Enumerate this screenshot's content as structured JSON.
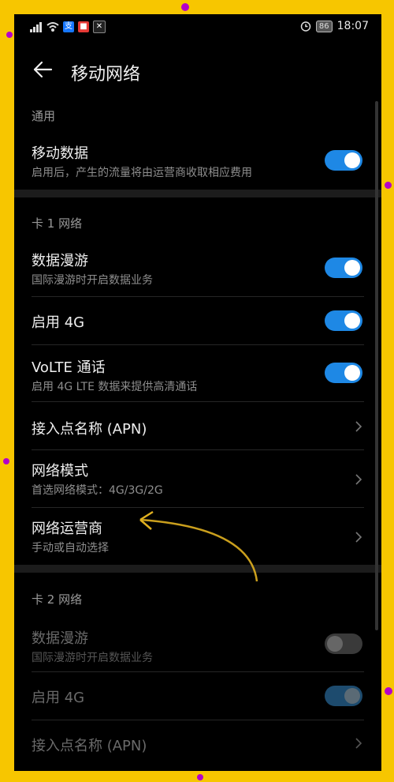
{
  "status_bar": {
    "battery": "86",
    "time": "18:07"
  },
  "header": {
    "title": "移动网络"
  },
  "general": {
    "section_label": "通用",
    "mobile_data": {
      "title": "移动数据",
      "subtitle": "启用后，产生的流量将由运营商收取相应费用",
      "on": true
    }
  },
  "sim1": {
    "section_label": "卡 1 网络",
    "roaming": {
      "title": "数据漫游",
      "subtitle": "国际漫游时开启数据业务",
      "on": true
    },
    "enable_4g": {
      "title": "启用 4G",
      "on": true
    },
    "volte": {
      "title": "VoLTE 通话",
      "subtitle": "启用 4G LTE 数据来提供高清通话",
      "on": true
    },
    "apn": {
      "title": "接入点名称 (APN)"
    },
    "network_mode": {
      "title": "网络模式",
      "subtitle": "首选网络模式：4G/3G/2G"
    },
    "carrier": {
      "title": "网络运营商",
      "subtitle": "手动或自动选择"
    }
  },
  "sim2": {
    "section_label": "卡 2 网络",
    "roaming": {
      "title": "数据漫游",
      "subtitle": "国际漫游时开启数据业务",
      "on": false
    },
    "enable_4g": {
      "title": "启用 4G",
      "on": true
    },
    "apn": {
      "title": "接入点名称 (APN)"
    }
  },
  "colors": {
    "toggle_on": "#1e88e5",
    "background": "#000000",
    "frame": "#f7c600",
    "annotation_arrow": "#e0b020"
  },
  "icons": [
    "signal-icon",
    "wifi-icon",
    "alipay-icon",
    "app-icon",
    "capcut-icon",
    "alarm-icon",
    "battery-icon",
    "back-arrow-icon",
    "chevron-right-icon"
  ]
}
